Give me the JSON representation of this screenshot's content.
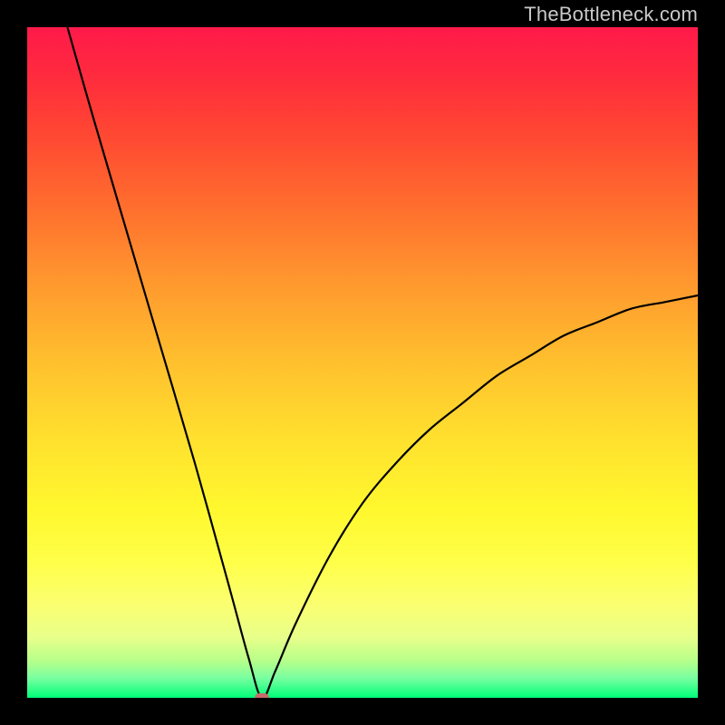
{
  "watermark": "TheBottleneck.com",
  "chart_data": {
    "type": "line",
    "title": "",
    "xlabel": "",
    "ylabel": "",
    "xlim": [
      0,
      100
    ],
    "ylim": [
      0,
      100
    ],
    "grid": false,
    "curve": {
      "description": "V-shaped bottleneck curve with vertex near x≈35, rising steeply to the left edge and asymptotically toward ~60 on the right edge.",
      "points": [
        {
          "x": 6,
          "y": 100
        },
        {
          "x": 10,
          "y": 86
        },
        {
          "x": 15,
          "y": 69
        },
        {
          "x": 20,
          "y": 52
        },
        {
          "x": 25,
          "y": 35
        },
        {
          "x": 30,
          "y": 17
        },
        {
          "x": 33,
          "y": 6
        },
        {
          "x": 35,
          "y": 0
        },
        {
          "x": 37,
          "y": 4
        },
        {
          "x": 40,
          "y": 11
        },
        {
          "x": 45,
          "y": 21
        },
        {
          "x": 50,
          "y": 29
        },
        {
          "x": 55,
          "y": 35
        },
        {
          "x": 60,
          "y": 40
        },
        {
          "x": 65,
          "y": 44
        },
        {
          "x": 70,
          "y": 48
        },
        {
          "x": 75,
          "y": 51
        },
        {
          "x": 80,
          "y": 54
        },
        {
          "x": 85,
          "y": 56
        },
        {
          "x": 90,
          "y": 58
        },
        {
          "x": 95,
          "y": 59
        },
        {
          "x": 100,
          "y": 60
        }
      ]
    },
    "marker": {
      "x": 35,
      "y": 0,
      "color": "#c86a6a"
    },
    "background_gradient": {
      "stops": [
        {
          "pos": 0,
          "color": "#ff1a4a"
        },
        {
          "pos": 50,
          "color": "#ffc02e"
        },
        {
          "pos": 80,
          "color": "#ffff4a"
        },
        {
          "pos": 100,
          "color": "#00ff7a"
        }
      ]
    }
  }
}
